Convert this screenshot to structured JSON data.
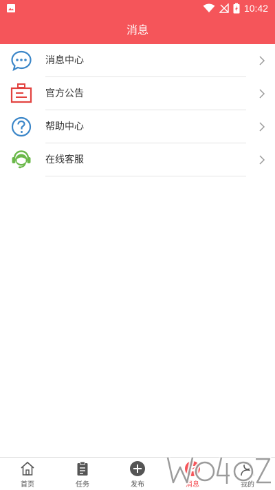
{
  "status_bar": {
    "time": "10:42",
    "icons": [
      "image-icon",
      "wifi-icon",
      "signal-icon",
      "battery-charging-icon"
    ]
  },
  "header": {
    "title": "消息"
  },
  "list": [
    {
      "label": "消息中心",
      "icon": "chat-bubble-icon",
      "color": "#3b86c8"
    },
    {
      "label": "官方公告",
      "icon": "notice-board-icon",
      "color": "#e2423f"
    },
    {
      "label": "帮助中心",
      "icon": "help-circle-icon",
      "color": "#3b86c8"
    },
    {
      "label": "在线客服",
      "icon": "customer-service-icon",
      "color": "#6bb84a"
    }
  ],
  "bottom_nav": [
    {
      "label": "首页",
      "icon": "home-icon"
    },
    {
      "label": "任务",
      "icon": "clipboard-icon"
    },
    {
      "label": "发布",
      "icon": "plus-circle-icon"
    },
    {
      "label": "消息",
      "icon": "message-icon",
      "active": true
    },
    {
      "label": "我的",
      "icon": "user-icon"
    }
  ],
  "colors": {
    "accent": "#f5555a",
    "text": "#333333",
    "divider": "#e3e3e3"
  }
}
